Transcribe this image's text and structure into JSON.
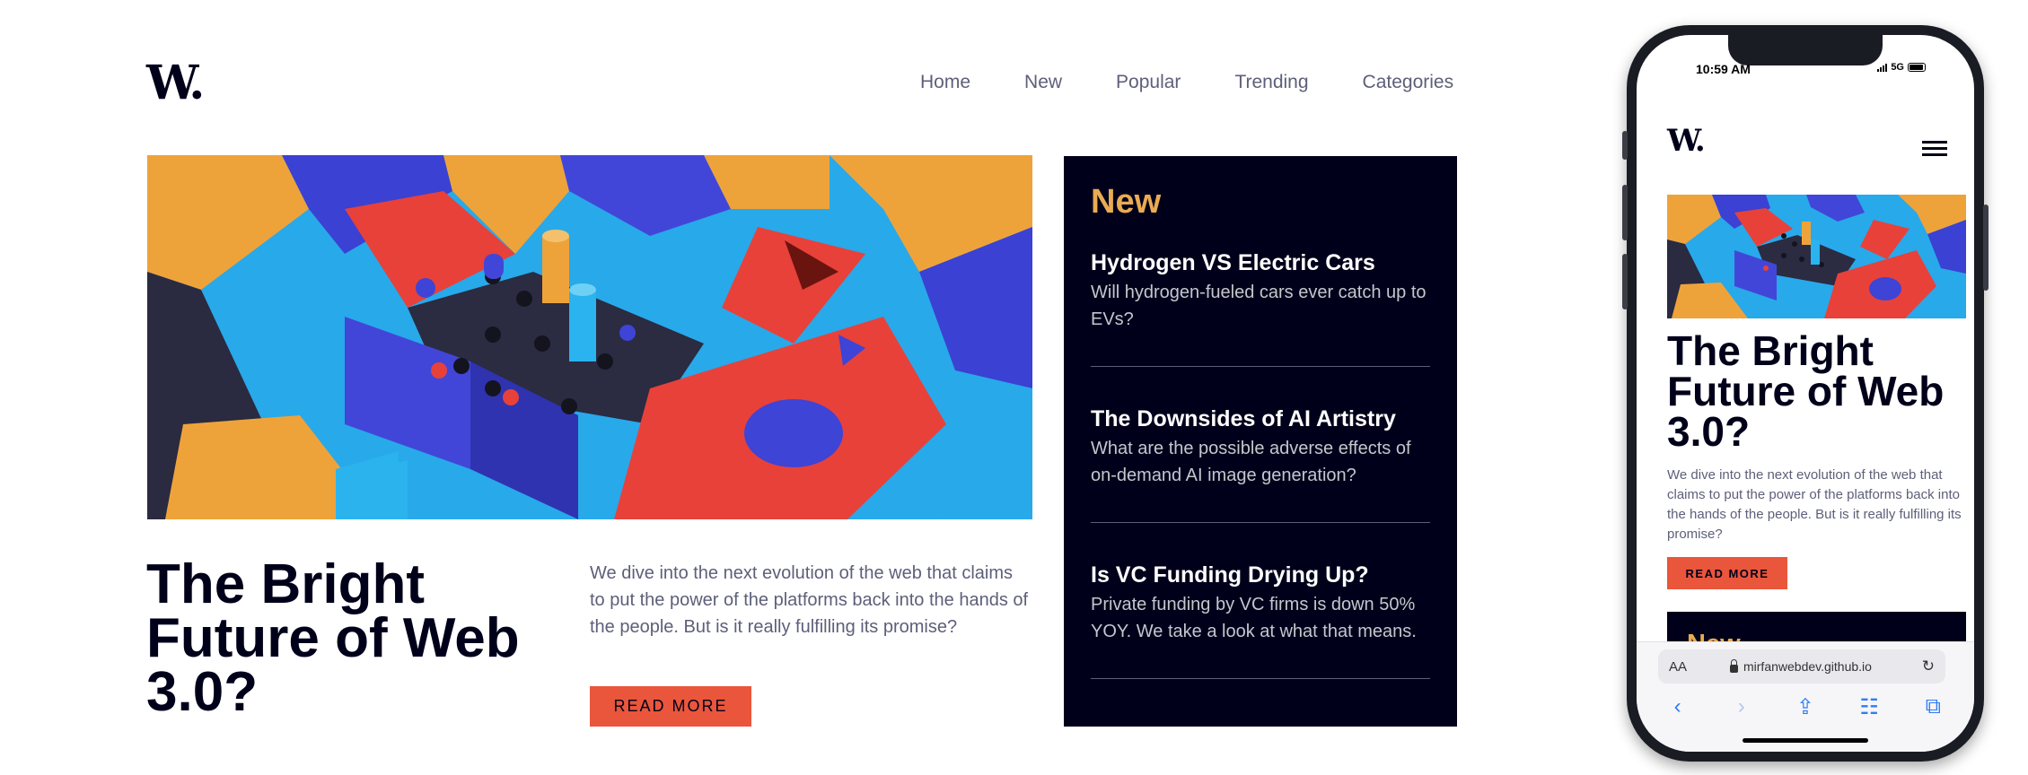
{
  "desktop": {
    "logo": "W.",
    "nav": [
      "Home",
      "New",
      "Popular",
      "Trending",
      "Categories"
    ],
    "headline": "The Bright Future of Web 3.0?",
    "intro": "We dive into the next evolution of the web that claims to put the power of the platforms back into the hands of the people. But is it really fulfilling its promise?",
    "read_more": "READ MORE",
    "new_section": {
      "title": "New",
      "items": [
        {
          "title": "Hydrogen VS Electric Cars",
          "text": "Will hydrogen-fueled cars ever catch up to EVs?"
        },
        {
          "title": "The Downsides of AI Artistry",
          "text": "What are the possible adverse effects of on-demand AI image generation?"
        },
        {
          "title": "Is VC Funding Drying Up?",
          "text": "Private funding by VC firms is down 50% YOY. We take a look at what that means."
        }
      ]
    }
  },
  "mobile": {
    "status_time": "10:59 AM",
    "network": "5G",
    "logo": "W.",
    "headline": "The Bright Future of Web 3.0?",
    "intro": "We dive into the next evolution of the web that claims to put the power of the platforms back into the hands of the people. But is it really fulfilling its promise?",
    "read_more": "READ MORE",
    "new_title": "New",
    "browser": {
      "aa": "AA",
      "url": "mirfanwebdev.github.io"
    }
  },
  "colors": {
    "navy": "#00001a",
    "accent_red": "#e9563b",
    "accent_orange": "#e9ab53",
    "gray_text": "#5d5f79",
    "safari_blue": "#2f7cf6"
  },
  "icons": [
    "menu-icon",
    "lock-icon",
    "reload-icon",
    "back-icon",
    "forward-icon",
    "share-icon",
    "bookmarks-icon",
    "tabs-icon"
  ]
}
